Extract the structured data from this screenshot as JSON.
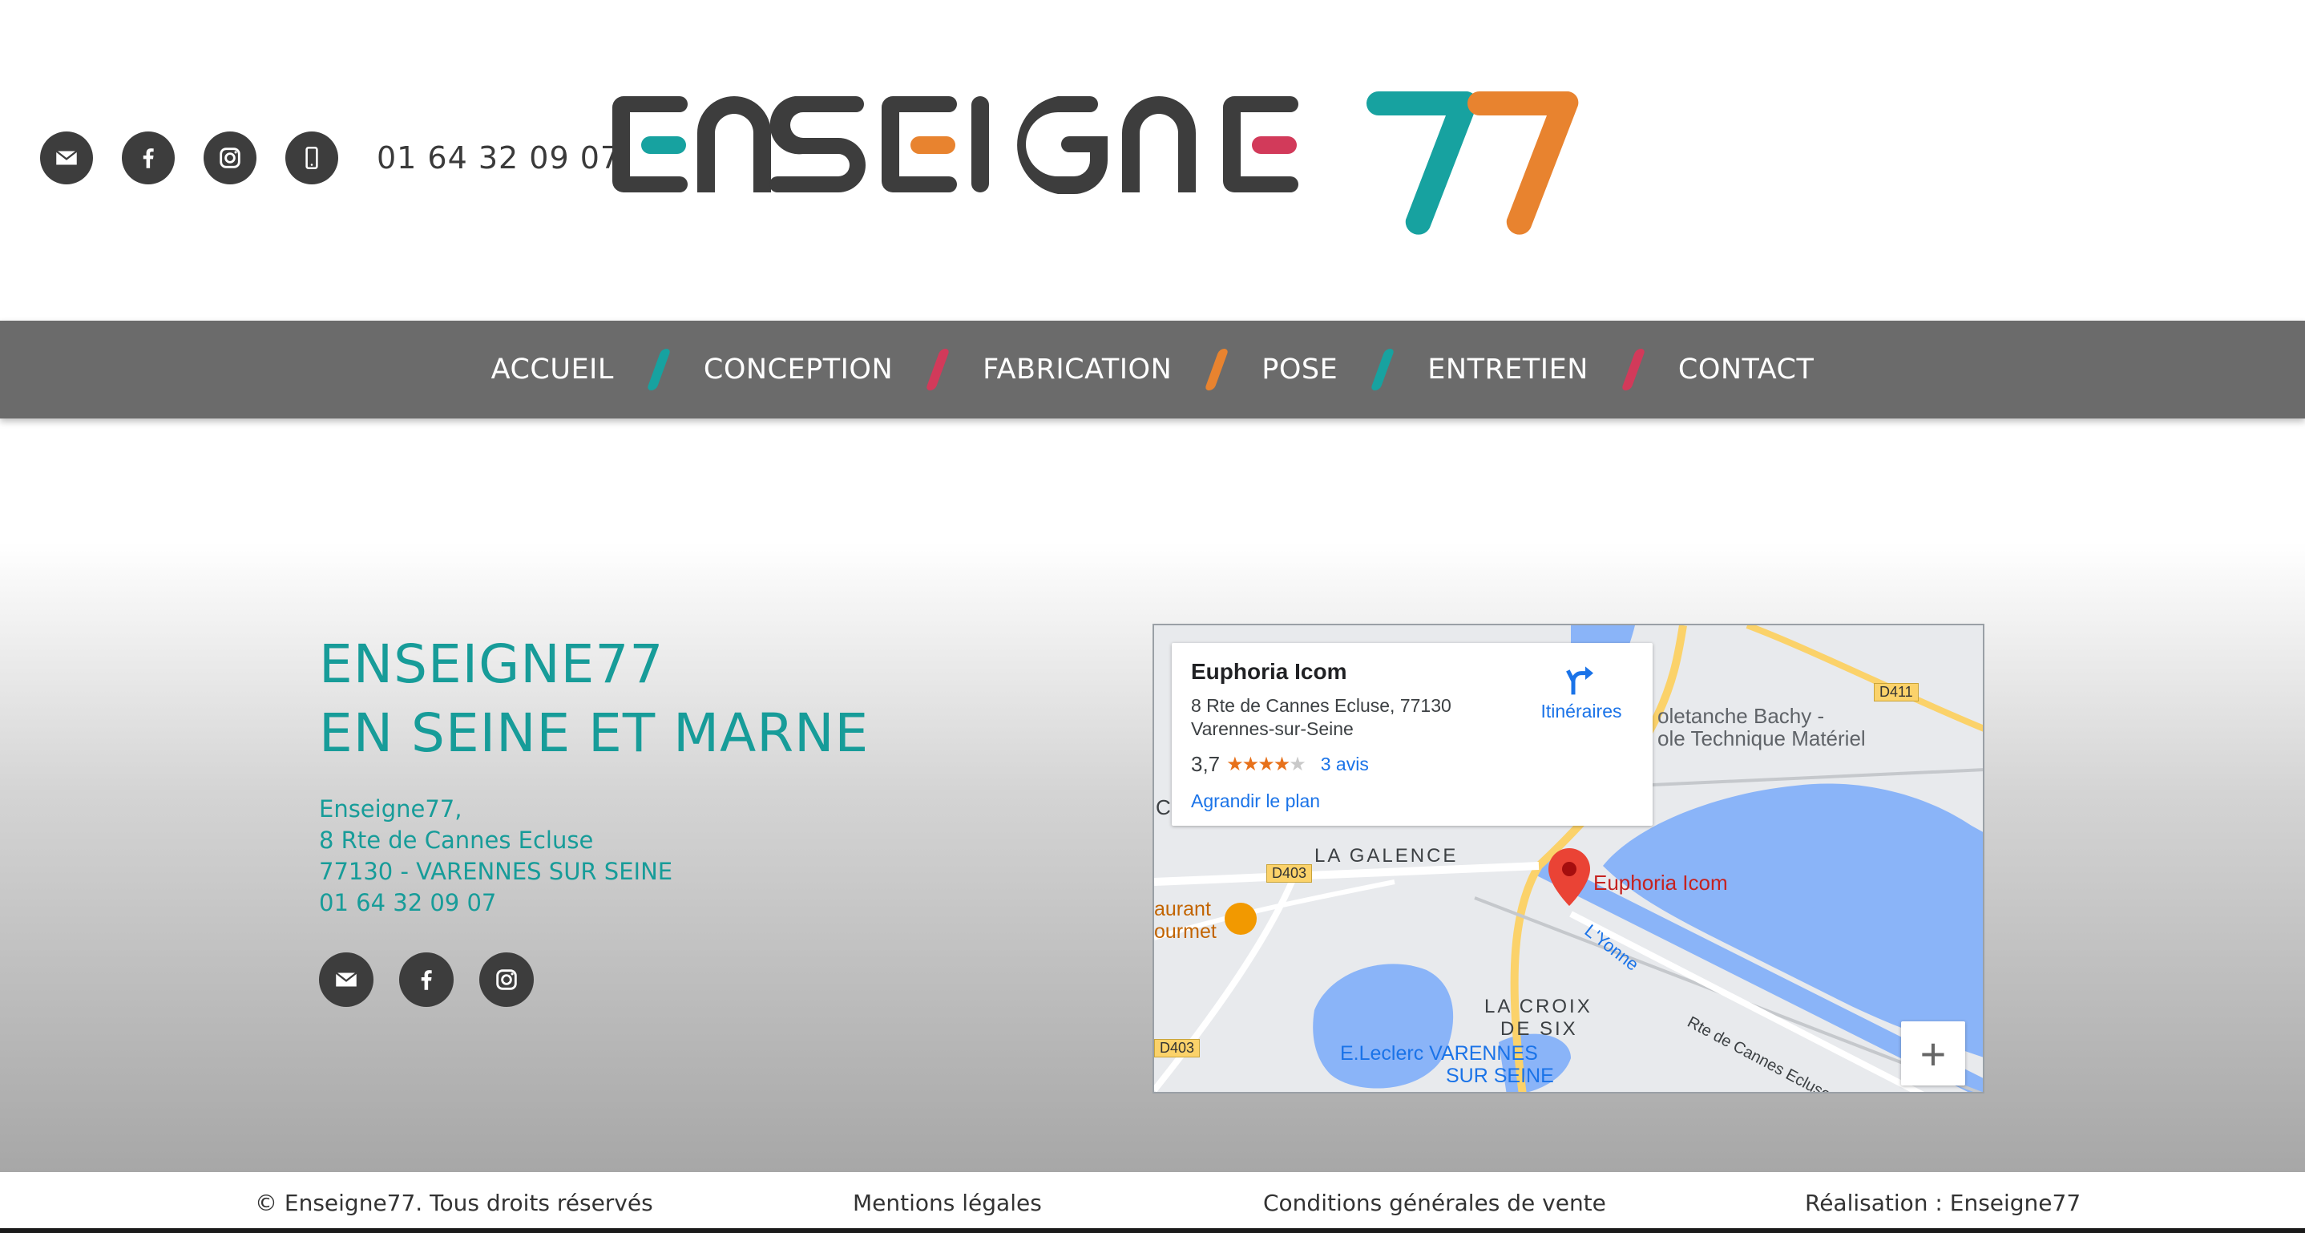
{
  "header": {
    "phone": "01 64 32 09 07",
    "icons": [
      "email-icon",
      "facebook-icon",
      "instagram-icon",
      "mobile-phone-icon"
    ],
    "logo": {
      "text": "ENSEIGNE",
      "number": "77"
    }
  },
  "nav": {
    "items": [
      {
        "label": "ACCUEIL",
        "slash_color": "#17a2a0"
      },
      {
        "label": "CONCEPTION",
        "slash_color": "#d23a5a"
      },
      {
        "label": "FABRICATION",
        "slash_color": "#e8832f"
      },
      {
        "label": "POSE",
        "slash_color": "#17a2a0"
      },
      {
        "label": "ENTRETIEN",
        "slash_color": "#d23a5a"
      },
      {
        "label": "CONTACT",
        "slash_color": null
      }
    ]
  },
  "contact": {
    "heading_line1": "ENSEIGNE77",
    "heading_line2": "EN SEINE ET MARNE",
    "address_lines": [
      "Enseigne77,",
      "8 Rte de Cannes Ecluse",
      "77130 - VARENNES SUR SEINE",
      "01 64 32 09 07"
    ]
  },
  "map": {
    "place_name": "Euphoria Icom",
    "address": "8 Rte de Cannes Ecluse, 77130 Varennes-sur-Seine",
    "rating": "3,7",
    "rating_value": 3.7,
    "reviews": "3 avis",
    "enlarge": "Agrandir le plan",
    "directions": "Itinéraires",
    "zoom_in": "+",
    "labels": {
      "galence": "LA GALENCE",
      "croix1": "LA CROIX",
      "croix2": "DE SIX",
      "leclerc1": "E.Leclerc VARENNES",
      "leclerc2": "SUR SEINE",
      "bachy1": "oletanche Bachy -",
      "bachy2": "ole Technique Matériel",
      "d411": "D411",
      "d403a": "D403",
      "d403b": "D403",
      "yonne": "L'Yonne",
      "route": "Rte de Cannes Ecluse",
      "resto1": "aurant",
      "resto2": "ourmet",
      "pin_label": "Euphoria Icom",
      "edge_c1": "C",
      "edge_c2": "C"
    }
  },
  "footer": {
    "copyright": "© Enseigne77. Tous droits réservés",
    "legal": "Mentions légales",
    "terms": "Conditions générales de vente",
    "credit": "Réalisation : Enseigne77"
  },
  "colors": {
    "teal": "#179c99",
    "pink": "#d23a5a",
    "orange": "#e8832f",
    "dark": "#3d3d3d",
    "nav_bg": "#6b6b6b"
  }
}
